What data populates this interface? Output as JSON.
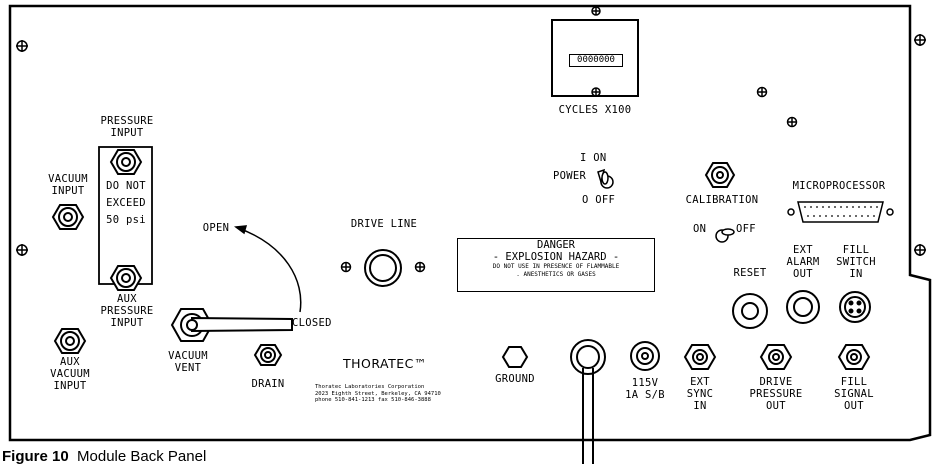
{
  "caption": {
    "label": "Figure 10",
    "text": "Module Back Panel"
  },
  "labels": {
    "cycles": "CYCLES X100",
    "counter_digits": "0000000",
    "pressure_input": [
      "PRESSURE",
      "INPUT"
    ],
    "vacuum_input": [
      "VACUUM",
      "INPUT"
    ],
    "do_not_exceed": [
      "DO NOT",
      "EXCEED",
      "50 psi"
    ],
    "aux_pressure_input": [
      "AUX",
      "PRESSURE",
      "INPUT"
    ],
    "aux_vacuum_input": [
      "AUX",
      "VACUUM",
      "INPUT"
    ],
    "open": "OPEN",
    "closed": "CLOSED",
    "vacuum_vent": [
      "VACUUM",
      "VENT"
    ],
    "drain": "DRAIN",
    "drive_line": "DRIVE LINE",
    "power_on": "I  ON",
    "power": "POWER",
    "power_off": "O OFF",
    "calibration": "CALIBRATION",
    "cal_on": "ON",
    "cal_off": "OFF",
    "microprocessor": "MICROPROCESSOR",
    "reset": "RESET",
    "ext_alarm_out": [
      "EXT",
      "ALARM",
      "OUT"
    ],
    "fill_switch_in": [
      "FILL",
      "SWITCH",
      "IN"
    ],
    "danger_title": "DANGER",
    "danger_hazard": "- EXPLOSION HAZARD -",
    "danger_line1": "DO NOT USE IN PRESENCE OF FLAMMABLE",
    "danger_line2": ".   ANESTHETICS OR GASES",
    "thoratec": "THORATEC™",
    "thoratec_addr1": "Thoratec Laboratories Corporation",
    "thoratec_addr2": "2023 Eighth Street, Berkeley, CA 94710",
    "thoratec_addr3": "phone 510-841-1213  fax 510-846-3888",
    "ground": "GROUND",
    "fuse": [
      "115V",
      "1A S/B"
    ],
    "ext_sync_in": [
      "EXT",
      "SYNC",
      "IN"
    ],
    "drive_pressure_out": [
      "DRIVE",
      "PRESSURE",
      "OUT"
    ],
    "fill_signal_out": [
      "FILL",
      "SIGNAL",
      "OUT"
    ]
  }
}
